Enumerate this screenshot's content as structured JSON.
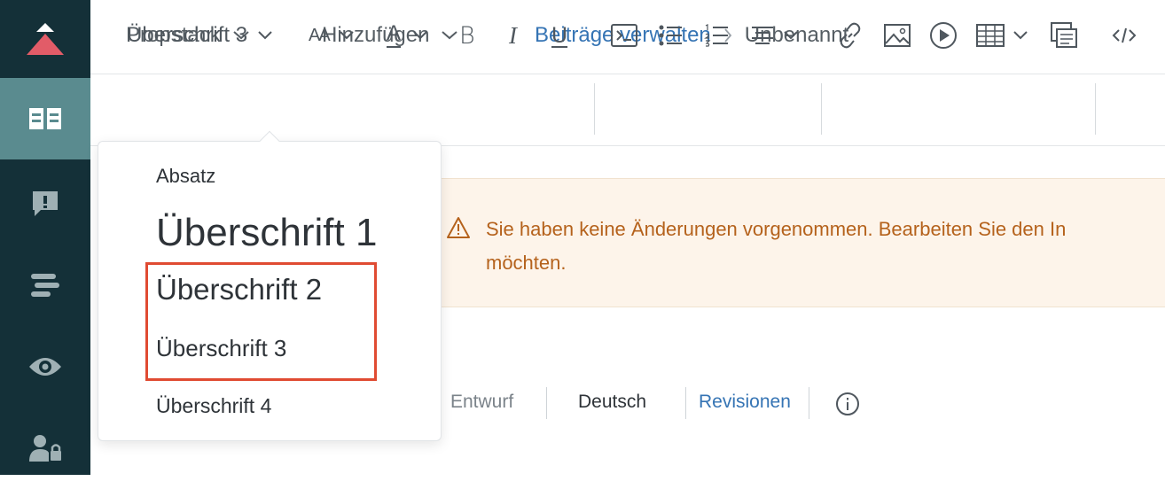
{
  "sidebar": {
    "items": [
      {
        "name": "logo-icon"
      },
      {
        "name": "posts-icon",
        "active": true
      },
      {
        "name": "alert-icon"
      },
      {
        "name": "layout-icon"
      },
      {
        "name": "eye-icon"
      },
      {
        "name": "user-lock-icon"
      }
    ]
  },
  "topnav": {
    "propstack": "Propstack",
    "add": "Hinzufügen",
    "manage_posts": "Beiträge verwalten",
    "current": "Unbenannt"
  },
  "toolbar": {
    "heading_select": "Überschrift 3",
    "font_size_glyph": "AA",
    "font_color_glyph": "A",
    "bold_glyph": "B",
    "italic_glyph": "I",
    "underline_glyph": "U"
  },
  "notice": {
    "line1": "Sie haben keine Änderungen vorgenommen. Bearbeiten Sie den In",
    "line2": "möchten."
  },
  "meta": {
    "status": "Entwurf",
    "language": "Deutsch",
    "revisions": "Revisionen"
  },
  "heading_dropdown": {
    "options": [
      "Absatz",
      "Überschrift 1",
      "Überschrift 2",
      "Überschrift 3",
      "Überschrift 4"
    ],
    "selected": "Überschrift 3"
  },
  "colors": {
    "sidebar": "#143038",
    "sidebar_active": "#5a8b8f",
    "link": "#3574b4",
    "warning_text": "#b5621c",
    "warning_bg": "#fdf4ea",
    "highlight": "#e04b32"
  }
}
